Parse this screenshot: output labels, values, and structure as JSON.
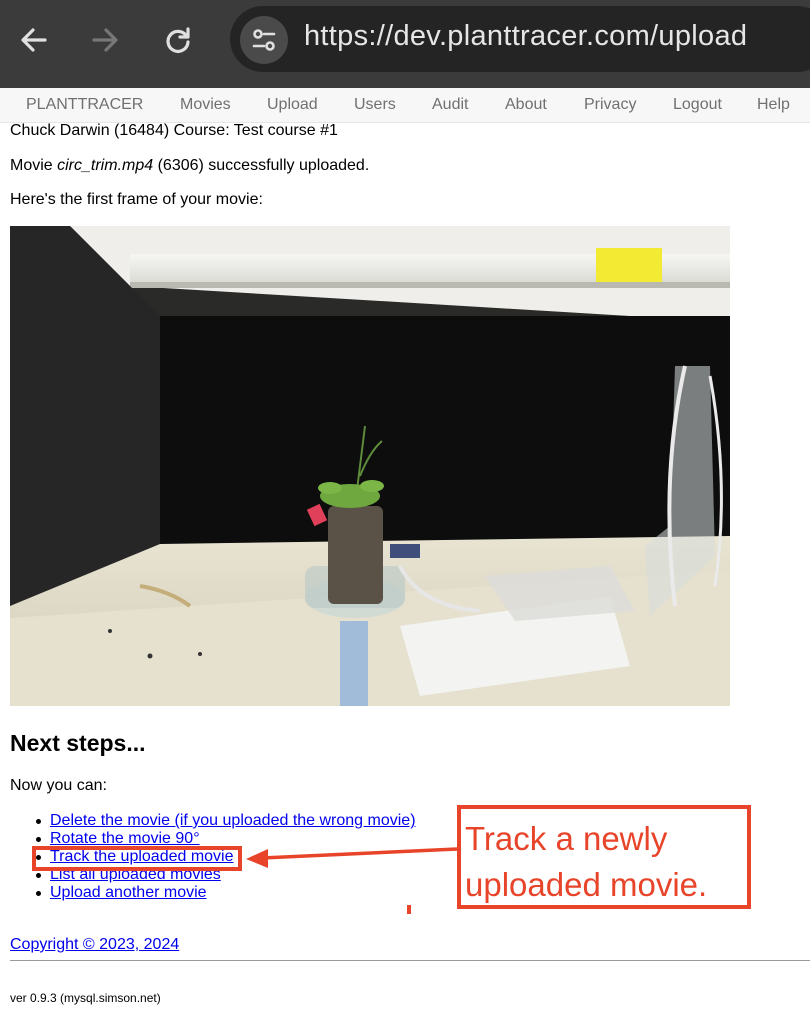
{
  "browser": {
    "url": "https://dev.planttracer.com/upload",
    "buttons": {
      "back": "back-arrow-icon",
      "forward": "forward-arrow-icon",
      "reload": "reload-icon",
      "site_info": "tune-icon"
    }
  },
  "nav": {
    "brand": "PLANTTRACER",
    "items": [
      "Movies",
      "Upload",
      "Users",
      "Audit",
      "About",
      "Privacy",
      "Logout",
      "Help"
    ]
  },
  "user_line": "Chuck Darwin (16484) Course: Test course #1",
  "upload_message": {
    "prefix": "Movie ",
    "filename": "circ_trim.mp4",
    "suffix": " (6306) successfully uploaded."
  },
  "first_frame_text": "Here's the first frame of your movie:",
  "next_steps": {
    "heading": "Next steps...",
    "intro": "Now you can:",
    "links": [
      "Delete the movie (if you uploaded the wrong movie)",
      "Rotate the movie 90°",
      "Track the uploaded movie",
      "List all uploaded movies",
      "Upload another movie"
    ]
  },
  "annotation": {
    "line1": "Track a newly",
    "line2": "uploaded movie.",
    "color": "#e8442a"
  },
  "footer": {
    "copyright": "Copyright © 2023, 2024",
    "version": "ver 0.9.3 (mysql.simson.net)"
  }
}
